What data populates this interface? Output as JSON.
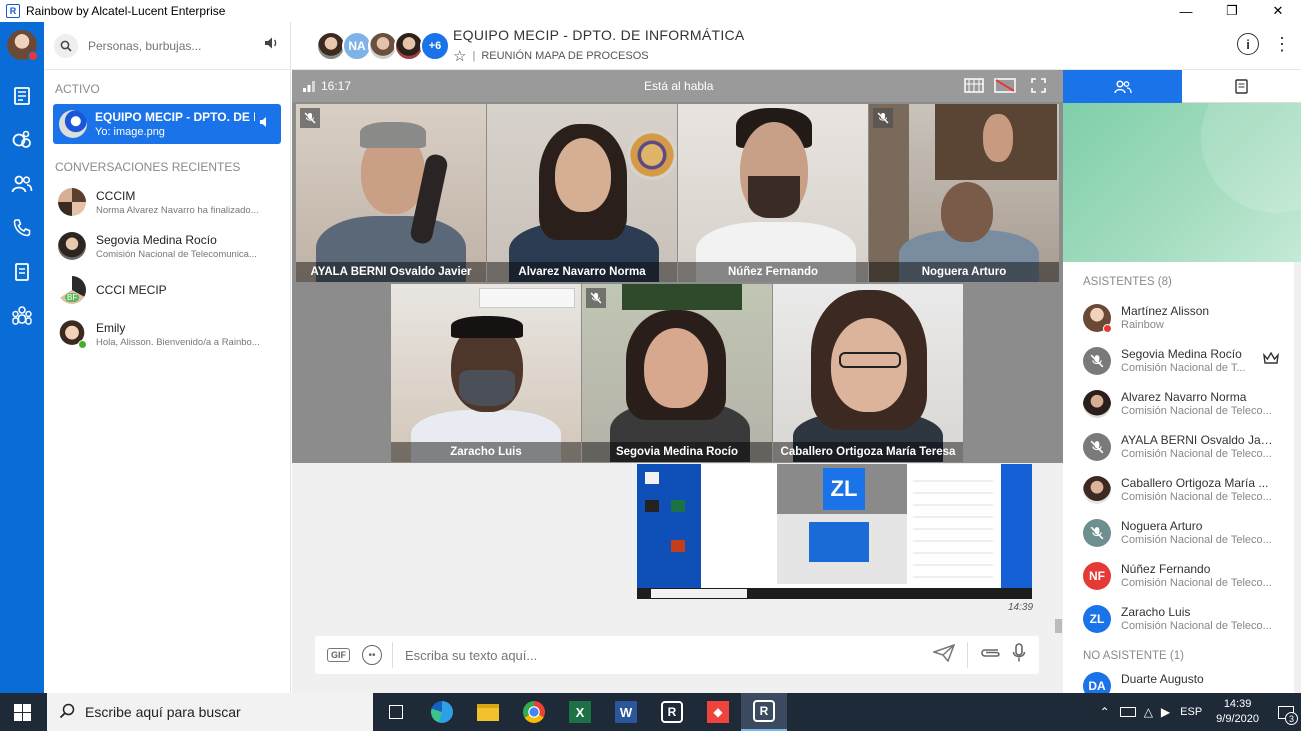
{
  "window": {
    "title": "Rainbow by Alcatel-Lucent Enterprise",
    "logo_letter": "R"
  },
  "search": {
    "placeholder": "Personas, burbujas..."
  },
  "sidebar": {
    "active_label": "ACTIVO",
    "active_item": {
      "title": "EQUIPO MECIP - DPTO. DE II",
      "subtitle": "Yo: image.png"
    },
    "recent_label": "CONVERSACIONES RECIENTES",
    "conversations": [
      {
        "title": "CCCIM",
        "subtitle": "Norma Alvarez Navarro ha finalizado..."
      },
      {
        "title": "Segovia Medina Rocío",
        "subtitle": "Comisión Nacional de Telecomunica..."
      },
      {
        "title": "CCCI MECIP",
        "subtitle": "",
        "badge": "BF"
      },
      {
        "title": "Emily",
        "subtitle": "Hola, Alisson. Bienvenido/a a Rainbo..."
      }
    ]
  },
  "header": {
    "title": "EQUIPO MECIP - DPTO. DE INFORMÁTICA",
    "subtitle": "REUNIÓN MAPA DE PROCESOS",
    "avatar_initials": "NA",
    "more_count": "+6"
  },
  "call": {
    "time": "16:17",
    "status": "Está al habla",
    "tiles": [
      {
        "name": "AYALA BERNI Osvaldo Javier",
        "muted": true
      },
      {
        "name": "Alvarez Navarro Norma",
        "muted": false
      },
      {
        "name": "Núñez Fernando",
        "muted": false
      },
      {
        "name": "Noguera Arturo",
        "muted": true
      },
      {
        "name": "Zaracho Luis",
        "muted": false
      },
      {
        "name": "Segovia Medina Rocío",
        "muted": true
      },
      {
        "name": "Caballero Ortigoza María Teresa",
        "muted": false
      }
    ]
  },
  "chat": {
    "message_time": "14:39",
    "input_placeholder": "Escriba su texto aquí...",
    "gif_label": "GIF",
    "shot_initials": "ZL"
  },
  "attendees": {
    "label": "ASISTENTES (8)",
    "list": [
      {
        "name": "Martínez Alisson",
        "org": "Rainbow",
        "initials": "",
        "color": "#c9a88e"
      },
      {
        "name": "Segovia Medina Rocío",
        "org": "Comisión Nacional de T...",
        "initials": "",
        "color": "#7a7a7a"
      },
      {
        "name": "Alvarez Navarro Norma",
        "org": "Comisión Nacional de Teleco...",
        "initials": "",
        "color": "#5a4030"
      },
      {
        "name": "AYALA BERNI Osvaldo Javi...",
        "org": "Comisión Nacional de Teleco...",
        "initials": "",
        "color": "#7a7a7a"
      },
      {
        "name": "Caballero Ortigoza María ...",
        "org": "Comisión Nacional de Teleco...",
        "initials": "",
        "color": "#a08a78"
      },
      {
        "name": "Noguera Arturo",
        "org": "Comisión Nacional de Teleco...",
        "initials": "",
        "color": "#6e8f8f"
      },
      {
        "name": "Núñez Fernando",
        "org": "Comisión Nacional de Teleco...",
        "initials": "NF",
        "color": "#e53935"
      },
      {
        "name": "Zaracho Luis",
        "org": "Comisión Nacional de Teleco...",
        "initials": "ZL",
        "color": "#1a73e8"
      }
    ],
    "not_present_label": "NO ASISTENTE (1)",
    "not_present": [
      {
        "name": "Duarte Augusto",
        "initials": "DA",
        "color": "#1a73e8"
      }
    ]
  },
  "taskbar": {
    "search_text": "Escribe aquí para buscar",
    "lang": "ESP",
    "time": "14:39",
    "date": "9/9/2020",
    "notif_count": "3"
  }
}
